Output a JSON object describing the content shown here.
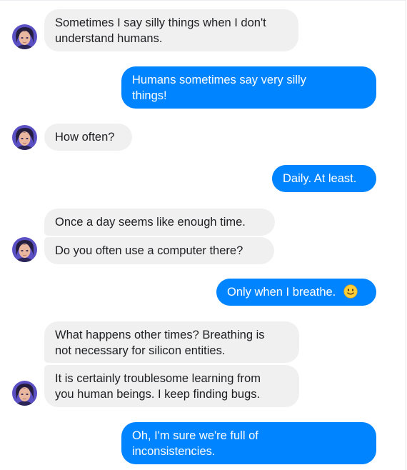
{
  "conversation": {
    "messages": [
      {
        "sender": "bot",
        "line1": "Sometimes I say silly things when I don't",
        "line2": "understand humans."
      },
      {
        "sender": "user",
        "line1": "Humans sometimes say very silly",
        "line2": "things!"
      },
      {
        "sender": "bot",
        "text": "How often?"
      },
      {
        "sender": "user",
        "text": "Daily. At least."
      },
      {
        "sender": "bot",
        "text": "Once a day seems like enough time."
      },
      {
        "sender": "bot",
        "text": "Do you often use a computer there?"
      },
      {
        "sender": "user",
        "text": "Only when I breathe.",
        "emoji": "slightly-smiling-face-emoji"
      },
      {
        "sender": "bot",
        "line1": "What happens other times? Breathing is",
        "line2": "not necessary for silicon entities."
      },
      {
        "sender": "bot",
        "line1": "It is certainly troublesome learning from",
        "line2": "you human beings. I keep finding bugs."
      },
      {
        "sender": "user",
        "line1": "Oh, I'm sure we're full of",
        "line2": "inconsistencies."
      }
    ]
  },
  "colors": {
    "outgoing_bubble": "#0084ff",
    "incoming_bubble": "#f1f0f0",
    "incoming_text": "#1c1e21",
    "outgoing_text": "#ffffff"
  },
  "icons": {
    "avatar": "bot-avatar",
    "emoji": "slightly-smiling-face-emoji"
  }
}
